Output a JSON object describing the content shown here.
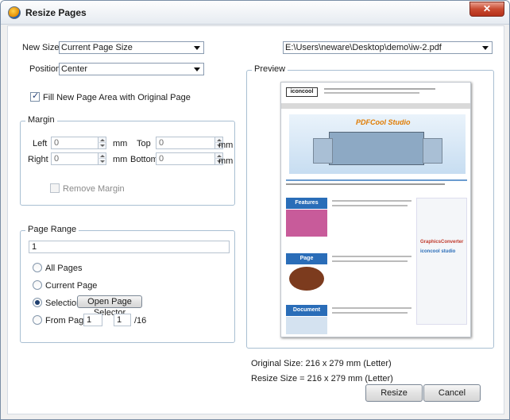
{
  "window": {
    "title": "Resize Pages",
    "close_glyph": "✕"
  },
  "form": {
    "new_size_label": "New Size",
    "new_size_value": "Current Page Size",
    "position_label": "Position",
    "position_value": "Center",
    "fill_label": "Fill New Page Area with Original Page",
    "fill_checked": true,
    "file_path": "E:\\Users\\neware\\Desktop\\demo\\iw-2.pdf"
  },
  "margin": {
    "title": "Margin",
    "left_label": "Left",
    "left_value": "0",
    "left_unit": "mm",
    "top_label": "Top",
    "top_value": "0",
    "top_unit": "mm",
    "right_label": "Right",
    "right_value": "0",
    "right_unit": "mm",
    "bottom_label": "Bottom",
    "bottom_value": "0",
    "bottom_unit": "mm",
    "remove_label": "Remove Margin"
  },
  "page_range": {
    "title": "Page Range",
    "value": "1",
    "all_pages": "All Pages",
    "current_page": "Current Page",
    "selection": "Selection",
    "open_selector": "Open Page Selector",
    "from_page": "From Page",
    "from_value": "1",
    "to_value": "1",
    "total": "/16",
    "selected": "Selection"
  },
  "preview": {
    "title": "Preview",
    "doc_logo": "iconcool",
    "doc_banner": "PDFCool Studio",
    "doc_sections": [
      "Features",
      "Page",
      "Document"
    ],
    "doc_side": [
      "GraphicsConverter",
      "iconcool studio"
    ]
  },
  "info": {
    "original_size": "Original Size: 216 x 279 mm (Letter)",
    "resize_size": "Resize Size = 216 x 279 mm (Letter)"
  },
  "buttons": {
    "resize": "Resize",
    "cancel": "Cancel"
  },
  "colors": {
    "accent": "#1f5fb4",
    "doc_blue": "#2a6db8"
  }
}
